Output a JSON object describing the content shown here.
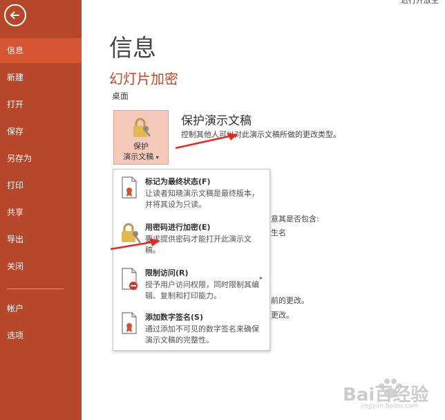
{
  "sidebar": {
    "items": [
      {
        "label": "信息",
        "active": true
      },
      {
        "label": "新建"
      },
      {
        "label": "打开"
      },
      {
        "label": "保存"
      },
      {
        "label": "另存为"
      },
      {
        "label": "打印"
      },
      {
        "label": "共享"
      },
      {
        "label": "导出"
      },
      {
        "label": "关闭"
      },
      {
        "label": "帐户"
      },
      {
        "label": "选项"
      }
    ]
  },
  "top_partial_text": "迟行开放主",
  "main": {
    "page_title": "信息",
    "doc_title": "幻灯片加密",
    "doc_path": "桌面",
    "protect_button": {
      "line1": "保护",
      "line2": "演示文稿",
      "caret": "▾",
      "icon": "lock-key-icon"
    },
    "section_title": "保护演示文稿",
    "section_desc": "控制其他人可以对此演示文稿所做的更改类型。",
    "bg_fragments": {
      "line1": "意其是否包含:",
      "line2": "生名",
      "line3": "前的更改。",
      "line4": "更改。"
    }
  },
  "dropdown": {
    "items": [
      {
        "title": "标记为最终状态(F)",
        "desc": "让读者知晓演示文稿是最终版本，并将其设为只读。",
        "icon": "final-document-icon"
      },
      {
        "title": "用密码进行加密(E)",
        "desc": "要求提供密码才能打开此演示文稿。",
        "icon": "lock-key-icon"
      },
      {
        "title": "限制访问(R)",
        "desc": "授予用户访问权限，同时限制其编辑、复制和打印能力。",
        "icon": "restrict-access-icon",
        "submenu": "▸"
      },
      {
        "title": "添加数字签名(S)",
        "desc": "通过添加不可见的数字签名来确保演示文稿的完整性。",
        "icon": "digital-signature-icon"
      }
    ]
  },
  "watermark": {
    "text": "Bai百经验",
    "sub": "jingyan.baidu.com"
  },
  "colors": {
    "sidebar": "#b7472a",
    "active": "#d65532",
    "accent_text": "#c2482a",
    "arrow": "#e8281e"
  }
}
